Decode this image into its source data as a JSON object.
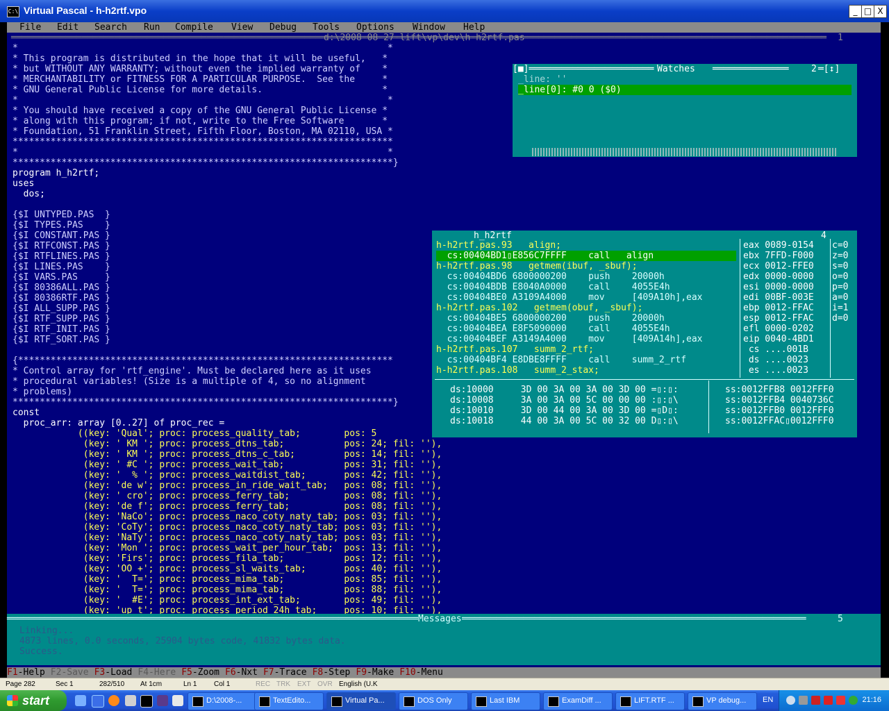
{
  "window": {
    "title": "Virtual Pascal - h-h2rtf.vpo",
    "minimize_glyph": "_",
    "maximize_glyph": "□",
    "close_glyph": "X"
  },
  "menu": [
    "File",
    "Edit",
    "Search",
    "Run",
    "Compile",
    "View",
    "Debug",
    "Tools",
    "Options",
    "Window",
    "Help"
  ],
  "editor": {
    "path": "d:\\2008-08-27-lift\\vp\\dev\\h-h2rtf.pas",
    "window_number": "1",
    "lines": [
      "*                                                                    *",
      "* This program is distributed in the hope that it will be useful,   *",
      "* but WITHOUT ANY WARRANTY; without even the implied warranty of    *",
      "* MERCHANTABILITY or FITNESS FOR A PARTICULAR PURPOSE.  See the     *",
      "* GNU General Public License for more details.                      *",
      "*                                                                    *",
      "* You should have received a copy of the GNU General Public License *",
      "* along with this program; if not, write to the Free Software       *",
      "* Foundation, 51 Franklin Street, Fifth Floor, Boston, MA 02110, USA *",
      "**********************************************************************",
      "*                                                                    *",
      "**********************************************************************}",
      "program h_h2rtf;",
      "uses",
      "  dos;",
      "",
      "{$I UNTYPED.PAS  }",
      "{$I TYPES.PAS    }",
      "{$I CONSTANT.PAS }",
      "{$I RTFCONST.PAS }",
      "{$I RTFLINES.PAS }",
      "{$I LINES.PAS    }",
      "{$I VARS.PAS     }",
      "{$I 80386ALL.PAS }",
      "{$I 80386RTF.PAS }",
      "{$I ALL_SUPP.PAS }",
      "{$I RTF_SUPP.PAS }",
      "{$I RTF_INIT.PAS }",
      "{$I RTF_SORT.PAS }",
      "",
      "{*********************************************************************",
      "* Control array for 'rtf_engine'. Must be declared here as it uses",
      "* procedural variables! (Size is a multiple of 4, so no alignment",
      "* problems)",
      "**********************************************************************}",
      "const",
      "  proc_arr: array [0..27] of proc_rec =",
      "            ((key: 'Qual'; proc: process_quality_tab;        pos: 5",
      "             (key: ' KM '; proc: process_dtns_tab;           pos: 24; fil: ''),",
      "             (key: ' KM '; proc: process_dtns_c_tab;         pos: 14; fil: ''),",
      "             (key: ' #C '; proc: process_wait_tab;           pos: 31; fil: ''),",
      "             (key: '  % '; proc: process_waitdist_tab;       pos: 42; fil: ''),",
      "             (key: 'de w'; proc: process_in_ride_wait_tab;   pos: 08; fil: ''),",
      "             (key: ' cro'; proc: process_ferry_tab;          pos: 08; fil: ''),",
      "             (key: 'de f'; proc: process_ferry_tab;          pos: 08; fil: ''),",
      "             (key: 'NaCo'; proc: process_naco_coty_naty_tab; pos: 03; fil: ''),",
      "             (key: 'CoTy'; proc: process_naco_coty_naty_tab; pos: 03; fil: ''),",
      "             (key: 'NaTy'; proc: process_naco_coty_naty_tab; pos: 03; fil: ''),",
      "             (key: 'Mon '; proc: process_wait_per_hour_tab;  pos: 13; fil: ''),",
      "             (key: 'Firs'; proc: process_fila_tab;           pos: 12; fil: ''),",
      "             (key: 'OO +'; proc: process_sl_waits_tab;       pos: 40; fil: ''),",
      "             (key: '  T='; proc: process_mima_tab;           pos: 85; fil: ''),",
      "             (key: '  T='; proc: process_mima_tab;           pos: 88; fil: ''),",
      "             (key: '  #E'; proc: process_int_ext_tab;        pos: 49; fil: ''),",
      "             (key: 'up t'; proc: process_period_24h_tab;     pos: 10; fil: ''),"
    ]
  },
  "watches": {
    "title": "Watches",
    "window_number": "2",
    "items": [
      "_line: ''",
      "_line[0]: #0 0 ($0)"
    ]
  },
  "cpu": {
    "title": "h_h2rtf",
    "window_number": "4",
    "code": [
      {
        "kind": "src",
        "text": "h-h2rtf.pas.93   align;"
      },
      {
        "kind": "hl",
        "text": "  cs:00404BD1▯E856C7FFFF    call   align"
      },
      {
        "kind": "src",
        "text": "h-h2rtf.pas.98   getmem(ibuf, _sbuf);"
      },
      {
        "kind": "asm",
        "text": "  cs:00404BD6 6800000200    push    20000h"
      },
      {
        "kind": "asm",
        "text": "  cs:00404BDB E8040A0000    call    4055E4h"
      },
      {
        "kind": "asm",
        "text": "  cs:00404BE0 A3109A4000    mov     [409A10h],eax"
      },
      {
        "kind": "src",
        "text": "h-h2rtf.pas.102   getmem(obuf, _sbuf);"
      },
      {
        "kind": "asm",
        "text": "  cs:00404BE5 6800000200    push    20000h"
      },
      {
        "kind": "asm",
        "text": "  cs:00404BEA E8F5090000    call    4055E4h"
      },
      {
        "kind": "asm",
        "text": "  cs:00404BEF A3149A4000    mov     [409A14h],eax"
      },
      {
        "kind": "src",
        "text": "h-h2rtf.pas.107   summ_2_rtf;"
      },
      {
        "kind": "asm",
        "text": "  cs:00404BF4 E8DBE8FFFF    call    summ_2_rtf"
      },
      {
        "kind": "src",
        "text": "h-h2rtf.pas.108   summ_2_stax;"
      }
    ],
    "registers": [
      "eax 0089-0154",
      "ebx 7FFD-F000",
      "ecx 0012-FFE0",
      "edx 0000-0000",
      "esi 0000-0000",
      "edi 00BF-003E",
      "ebp 0012-FFAC",
      "esp 0012-FFAC",
      "efl 0000-0202",
      "eip 0040-4BD1",
      " cs ....001B",
      " ds ....0023",
      " es ....0023"
    ],
    "flags": [
      "c=0",
      "z=0",
      "s=0",
      "o=0",
      "p=0",
      "a=0",
      "i=1",
      "d=0"
    ],
    "dump": [
      "ds:10000     3D 00 3A 00 3A 00 3D 00 =▯:▯:",
      "ds:10008     3A 00 3A 00 5C 00 00 00 :▯:▯\\",
      "ds:10010     3D 00 44 00 3A 00 3D 00 =▯D▯:",
      "ds:10018     44 00 3A 00 5C 00 32 00 D▯:▯\\"
    ],
    "stack": [
      "ss:0012FFB8 0012FFF0",
      "ss:0012FFB4 0040736C",
      "ss:0012FFB0 0012FFF0",
      "ss:0012FFAC▯0012FFF0"
    ]
  },
  "messages": {
    "title": "Messages",
    "window_number": "5",
    "lines": [
      "Linking...",
      "4873 lines, 0.0 seconds, 25904 bytes code, 41832 bytes data.",
      "Success."
    ]
  },
  "fkeys": [
    {
      "key": "F1",
      "label": "-Help",
      "enabled": true
    },
    {
      "key": "F2",
      "label": "-Save",
      "enabled": false
    },
    {
      "key": "F3",
      "label": "-Load",
      "enabled": true
    },
    {
      "key": "F4",
      "label": "-Here",
      "enabled": false
    },
    {
      "key": "F5",
      "label": "-Zoom",
      "enabled": true
    },
    {
      "key": "F6",
      "label": "-Nxt",
      "enabled": true
    },
    {
      "key": "F7",
      "label": "-Trace",
      "enabled": true
    },
    {
      "key": "F8",
      "label": "-Step",
      "enabled": true
    },
    {
      "key": "F9",
      "label": "-Make",
      "enabled": true
    },
    {
      "key": "F10",
      "label": "-Menu",
      "enabled": true
    }
  ],
  "word_status": {
    "page": "Page 282",
    "sec": "Sec 1",
    "pages": "282/510",
    "at": "At 1cm",
    "ln": "Ln 1",
    "col": "Col 1",
    "rec": "REC",
    "trk": "TRK",
    "ext": "EXT",
    "ovr": "OVR",
    "lang": "English (U.K"
  },
  "taskbar": {
    "start_label": "start",
    "tasks": [
      "D:\\2008-...",
      "TextEdito...",
      "Virtual Pa...",
      "DOS Only",
      "Last IBM",
      "ExamDiff ...",
      "LIFT.RTF ...",
      "VP debug..."
    ],
    "active_task": "Virtual Pa...",
    "lang": "EN",
    "clock": "21:16"
  },
  "colors": {
    "ide_background": "#00007c",
    "panel_teal": "#008a8a",
    "highlight_green": "#00a000",
    "menu_grey": "#8a8a8a",
    "hotkey_red": "#8b0000",
    "xp_blue": "#245edb"
  }
}
